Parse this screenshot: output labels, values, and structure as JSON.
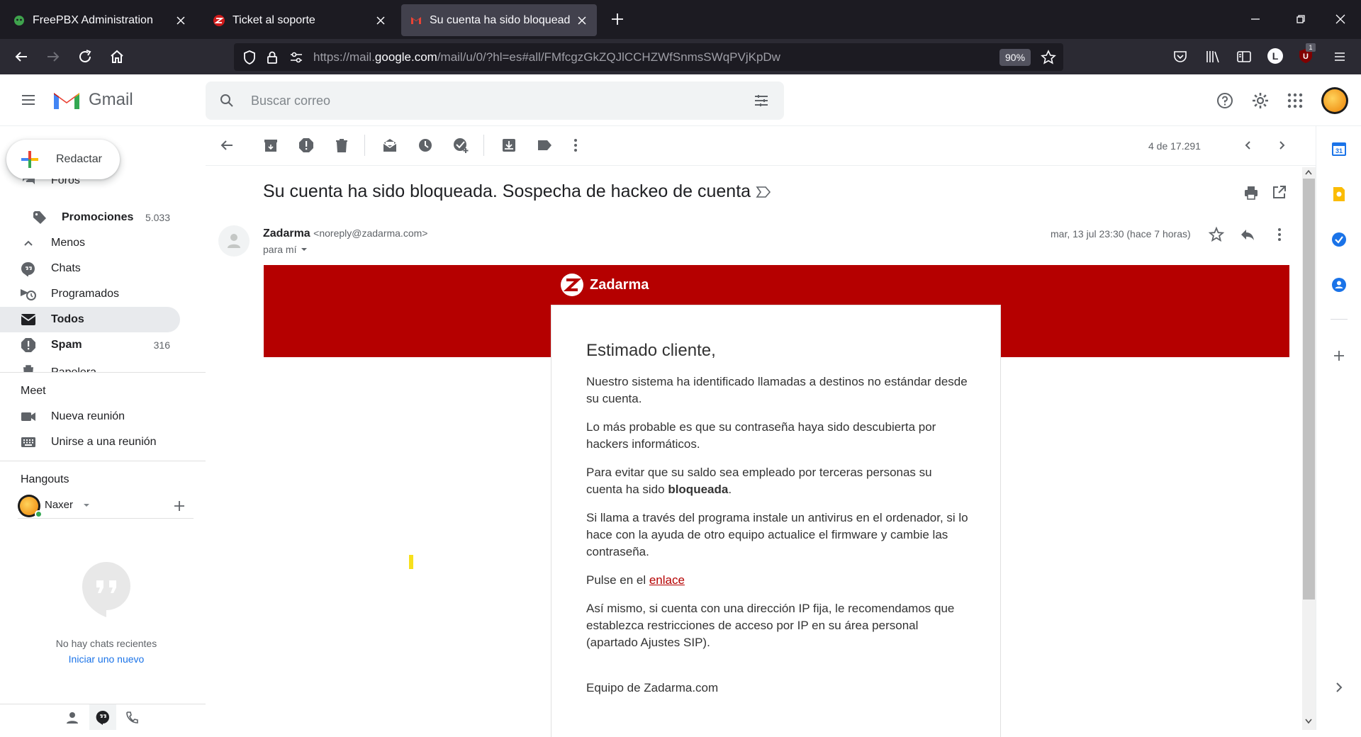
{
  "browser": {
    "tabs": [
      {
        "label": "FreePBX Administration",
        "icon": "freepbx-icon"
      },
      {
        "label": "Ticket al soporte",
        "icon": "zadarma-icon"
      },
      {
        "label": "Su cuenta ha sido bloqueada. S",
        "icon": "gmail-icon"
      }
    ],
    "url_prefix": "https://mail.",
    "url_host": "google.com",
    "url_rest": "/mail/u/0/?hl=es#all/FMfcgzGkZQJlCCHZWfSnmsSWqPVjKpDw",
    "zoom": "90%",
    "ublock_count": "1",
    "account_initial": "L"
  },
  "gmail": {
    "logo_text": "Gmail",
    "search_placeholder": "Buscar correo",
    "compose_label": "Redactar",
    "nav": [
      {
        "label": "Foros",
        "icon": "forums-icon"
      },
      {
        "label": "Promociones",
        "icon": "tag-icon",
        "count": "5.033"
      },
      {
        "label": "Menos",
        "icon": "chevron-up-icon"
      },
      {
        "label": "Chats",
        "icon": "chat-icon"
      },
      {
        "label": "Programados",
        "icon": "scheduled-icon"
      },
      {
        "label": "Todos",
        "icon": "all-mail-icon"
      },
      {
        "label": "Spam",
        "icon": "spam-icon",
        "count": "316"
      },
      {
        "label": "Papelera",
        "icon": "trash-icon"
      }
    ],
    "meet": {
      "title": "Meet",
      "new_meeting": "Nueva reunión",
      "join_meeting": "Unirse a una reunión"
    },
    "hangouts": {
      "title": "Hangouts",
      "user": "Naxer",
      "empty_text": "No hay chats recientes",
      "start_link": "Iniciar uno nuevo"
    },
    "pagination": "4 de 17.291"
  },
  "email": {
    "subject": "Su cuenta ha sido bloqueada. Sospecha de hackeo de cuenta",
    "sender_name": "Zadarma",
    "sender_email": "<noreply@zadarma.com>",
    "to": "para mí",
    "date": "mar, 13 jul 23:30 (hace 7 horas)",
    "brand": "Zadarma",
    "greeting": "Estimado cliente,",
    "p1": "Nuestro sistema ha identificado llamadas a destinos no estándar desde su cuenta.",
    "p2": "Lo más probable es que su contraseña haya sido descubierta por hackers informáticos.",
    "p3_before": "Para evitar que su saldo sea empleado por terceras personas su cuenta ha sido ",
    "p3_bold": "bloqueada",
    "p3_after": ".",
    "p4": "Si llama a través del programa instale un antivirus en el ordenador, si lo hace con la ayuda de otro equipo actualice el firmware y cambie las contraseña.",
    "p5_before": "Pulse en el ",
    "p5_link": "enlace",
    "p6": "Así mismo, si cuenta con una dirección IP fija, le recomendamos que establezca restricciones de acceso por IP en su área personal (apartado Ajustes SIP).",
    "signature": "Equipo de Zadarma.com"
  },
  "colors": {
    "brand_red": "#b50000",
    "link_red": "#b50000",
    "browser_bg": "#1c1b22",
    "gmail_blue": "#1a73e8"
  }
}
